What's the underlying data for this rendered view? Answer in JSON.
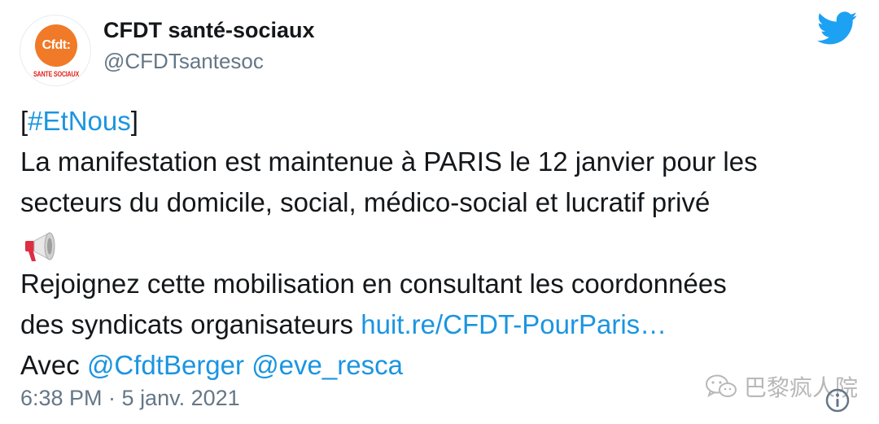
{
  "account": {
    "display_name": "CFDT santé-sociaux",
    "handle": "@CFDTsantesoc",
    "avatar_logo_text": "Cfdt:",
    "avatar_subtext": "SANTE SOCIAUX"
  },
  "tweet": {
    "bracket_open": "[",
    "hashtag": "#EtNous",
    "bracket_close": "]",
    "line2": "La manifestation est maintenue à PARIS le 12 janvier pour les",
    "line3": "secteurs du domicile, social, médico-social et lucratif privé",
    "line4_emoji": "megaphone",
    "line5": "Rejoignez cette mobilisation en consultant les coordonnées",
    "line6_text": "des syndicats organisateurs ",
    "line6_link": "huit.re/CFDT-PourParis…",
    "line7_prefix": "Avec ",
    "mention1": "@CfdtBerger",
    "mention2": "@eve_resca"
  },
  "timestamp": "6:38 PM · 5 janv. 2021",
  "watermark": {
    "text": "巴黎疯人院"
  },
  "icons": {
    "twitter_logo": "twitter-bird-icon",
    "info": "info-icon",
    "watermark": "wechat-icon"
  },
  "colors": {
    "link": "#1b95e0",
    "twitter_blue": "#1da1f2",
    "text": "#14171a",
    "secondary": "#657786",
    "avatar_orange": "#f07a28"
  }
}
